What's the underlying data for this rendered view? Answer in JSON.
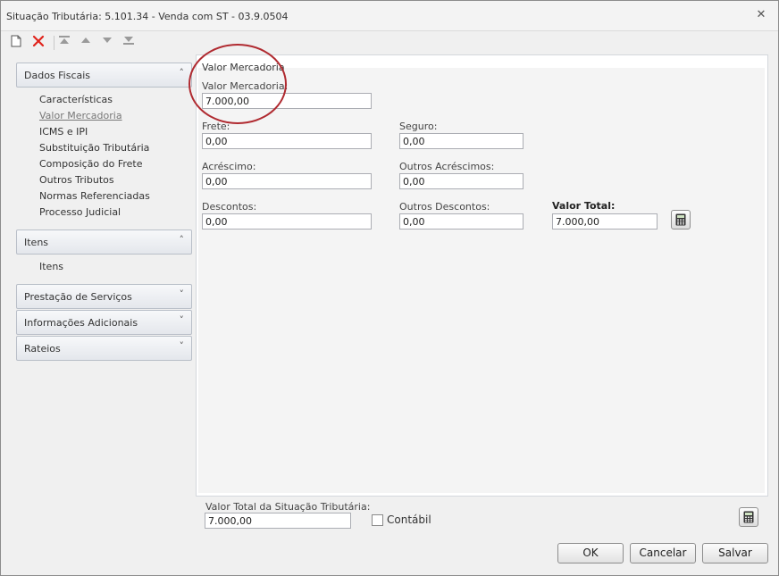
{
  "window": {
    "title": "Situação Tributária: 5.101.34 - Venda com ST - 03.9.0504"
  },
  "toolbar": {
    "icons": [
      "new-document-icon",
      "delete-icon",
      "move-first-icon",
      "move-up-icon",
      "move-down-icon",
      "move-last-icon"
    ],
    "delete_color": "#e0231b"
  },
  "sidebar": {
    "dados_fiscais": {
      "label": "Dados Fiscais",
      "items": [
        "Características",
        "Valor Mercadoria",
        "ICMS e IPI",
        "Substituição Tributária",
        "Composição do Frete",
        "Outros Tributos",
        "Normas Referenciadas",
        "Processo Judicial"
      ],
      "active": "Valor Mercadoria"
    },
    "itens": {
      "label": "Itens",
      "items": [
        "Itens"
      ]
    },
    "prestacao": {
      "label": "Prestação de Serviços"
    },
    "informacoes": {
      "label": "Informações Adicionais"
    },
    "rateios": {
      "label": "Rateios"
    }
  },
  "form": {
    "section_title": "Valor Mercadoria",
    "valor_mercadoria": {
      "label": "Valor Mercadoria:",
      "value": "7.000,00"
    },
    "frete": {
      "label": "Frete:",
      "value": "0,00"
    },
    "seguro": {
      "label": "Seguro:",
      "value": "0,00"
    },
    "acrescimo": {
      "label": "Acréscimo:",
      "value": "0,00"
    },
    "outros_acrescimos": {
      "label": "Outros Acréscimos:",
      "value": "0,00"
    },
    "descontos": {
      "label": "Descontos:",
      "value": "0,00"
    },
    "outros_descontos": {
      "label": "Outros Descontos:",
      "value": "0,00"
    },
    "valor_total": {
      "label": "Valor Total:",
      "value": "7.000,00"
    }
  },
  "bottom": {
    "valor_total_situacao": {
      "label": "Valor Total da Situação Tributária:",
      "value": "7.000,00"
    },
    "contabil": {
      "label": "Contábil",
      "checked": false
    }
  },
  "buttons": {
    "ok": "OK",
    "cancelar": "Cancelar",
    "salvar": "Salvar"
  },
  "colors": {
    "highlight": "#b02a30",
    "window_bg": "#f0f0f0"
  }
}
